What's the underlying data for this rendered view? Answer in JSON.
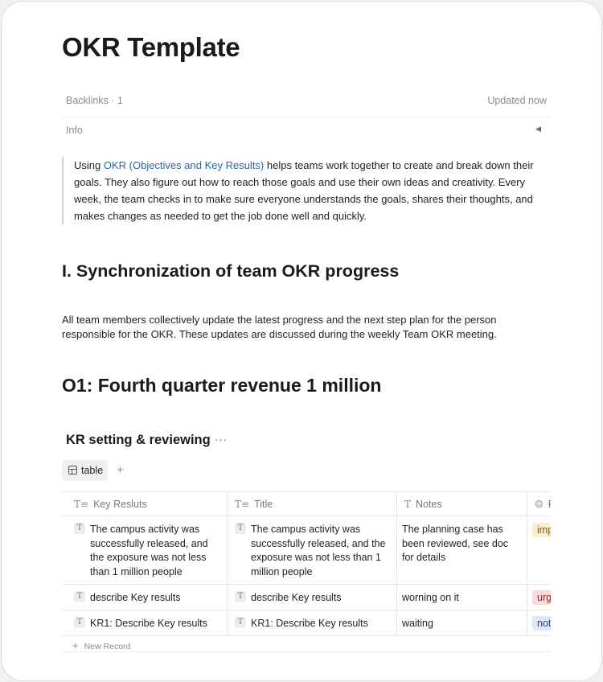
{
  "page": {
    "title": "OKR Template",
    "backlinks": "Backlinks · 1",
    "updated": "Updated now",
    "info_label": "Info"
  },
  "quote": {
    "prefix": "Using ",
    "link_text": "OKR (Objectives and Key Results)",
    "suffix": " helps teams work together to create and break down their goals. They also figure out how to reach those goals and use their own ideas and creativity. Every week, the team checks in to make sure everyone understands the goals, shares their thoughts, and makes changes as needed to get the job done well and quickly."
  },
  "section1": {
    "heading": "I. Synchronization of team OKR progress",
    "paragraph": "All team members collectively update the latest progress and the next step plan for the person responsible for the OKR. These updates are discussed during the weekly Team OKR meeting."
  },
  "section2": {
    "heading": "O1: Fourth quarter revenue 1 million"
  },
  "database": {
    "title": "KR setting & reviewing",
    "more": "···",
    "view_tab": "table",
    "add_view": "+",
    "columns": [
      {
        "label": "Key Resluts",
        "icon": "T≡"
      },
      {
        "label": "Title",
        "icon": "T≡"
      },
      {
        "label": "Notes",
        "icon": "T"
      },
      {
        "label": "P",
        "icon": "☺"
      }
    ],
    "rows": [
      {
        "key_result": "The campus activity was successfully released, and the exposure was not less than 1 million people",
        "title": "The campus activity was successfully released, and the exposure was not less than 1 million people",
        "notes": "The planning case has been reviewed, see doc for details",
        "tag": "imp"
      },
      {
        "key_result": "describe Key results",
        "title": "describe Key results",
        "notes": "worning on it",
        "tag": "urg"
      },
      {
        "key_result": "KR1: Describe Key results",
        "title": "KR1: Describe Key results",
        "notes": "waiting",
        "tag": "not"
      }
    ],
    "new_record": "New Record",
    "new_record_plus": "+"
  },
  "colors": {
    "link": "#2c63a8",
    "tag_imp": "#fbeecf",
    "tag_urg": "#fbd9d9",
    "tag_not": "#dde8f8"
  }
}
